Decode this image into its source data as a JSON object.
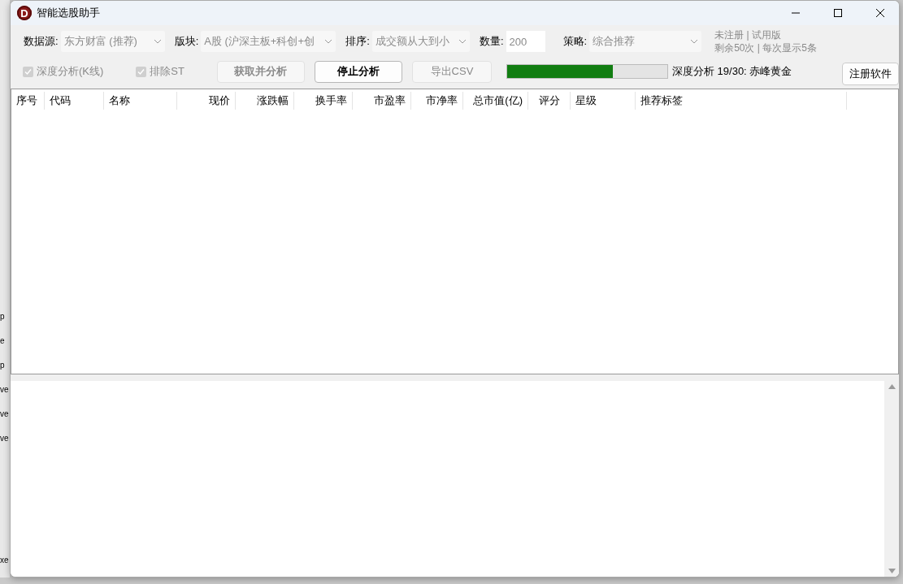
{
  "background_fragments": [
    "p",
    "e",
    "p",
    "ve",
    "ve",
    "ve",
    "xe"
  ],
  "window": {
    "logo": "D",
    "title": "智能选股助手"
  },
  "toolbar": {
    "row1": [
      {
        "kind": "select",
        "label": "数据源:",
        "value": "东方财富 (推荐)",
        "disabled": true
      },
      {
        "kind": "select",
        "label": "版块:",
        "value": "A股 (沪深主板+科创+创",
        "disabled": true
      },
      {
        "kind": "select",
        "label": "排序:",
        "value": "成交额从大到小",
        "disabled": true
      },
      {
        "kind": "input",
        "label": "数量:",
        "value": "200",
        "disabled": true
      },
      {
        "kind": "select",
        "label": "策略:",
        "value": "综合推荐",
        "disabled": true
      }
    ],
    "license": [
      "未注册 | 试用版",
      "剩余50次 | 每次显示5条"
    ],
    "row2": [
      {
        "kind": "checkbox",
        "label": "深度分析(K线)",
        "checked": true,
        "disabled": true
      },
      {
        "kind": "checkbox",
        "label": "排除ST",
        "checked": true,
        "disabled": true
      },
      {
        "kind": "button",
        "label": "获取并分析",
        "disabled": true
      },
      {
        "kind": "button",
        "label": "停止分析",
        "disabled": false
      },
      {
        "kind": "button",
        "label": "导出CSV",
        "disabled": true
      }
    ],
    "progress": {
      "level": 0.66,
      "text": "深度分析 19/30: 赤峰黄金"
    },
    "register_button": "注册软件"
  },
  "table": {
    "columns": [
      "序号",
      "代码",
      "名称",
      "现价",
      "涨跌幅",
      "换手率",
      "市盈率",
      "市净率",
      "总市值(亿)",
      "评分",
      "星级",
      "推荐标签"
    ]
  }
}
